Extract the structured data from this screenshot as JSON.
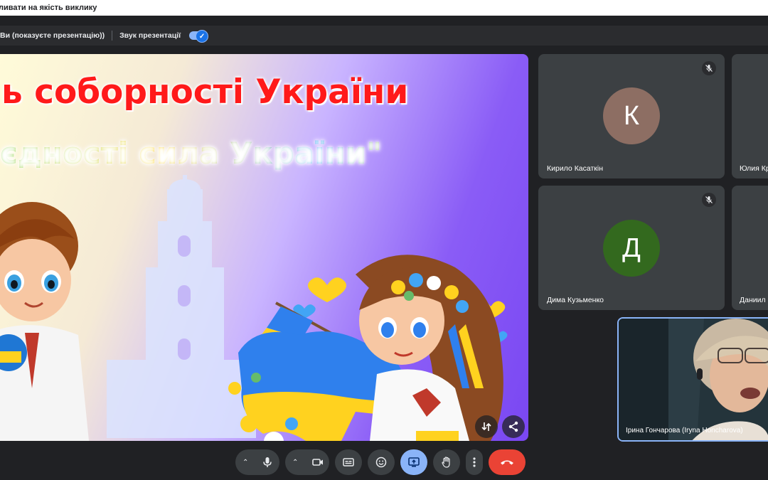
{
  "banner": {
    "text": "ливати на якість виклику"
  },
  "presentation_bar": {
    "presenter_text": "Ви (показуєте презентацію))",
    "sound_label": "Звук презентації",
    "sound_enabled": true
  },
  "slide": {
    "title": "ь соборності України",
    "subtitle": "єдності сила України\""
  },
  "participants": [
    {
      "name": "Кирило Касаткін",
      "initial": "К",
      "avatar_color": "#8d6e63",
      "muted": true
    },
    {
      "name": "Юлия Кр",
      "initial": "",
      "avatar_color": "",
      "muted": false
    },
    {
      "name": "Дима Кузьменко",
      "initial": "Д",
      "avatar_color": "#33691e",
      "muted": true
    },
    {
      "name": "Даниил",
      "initial": "",
      "avatar_color": "",
      "muted": false
    }
  ],
  "self_view": {
    "name": "Ірина Гончарова (Iryna Honcharova)"
  },
  "controls": {
    "icons": [
      "chevron-up-icon",
      "microphone-icon",
      "chevron-up-icon",
      "camera-icon",
      "captions-icon",
      "emoji-icon",
      "present-screen-icon",
      "raise-hand-icon",
      "more-options-icon",
      "end-call-icon"
    ],
    "colors": {
      "present_active": "#8ab4f8",
      "end_call": "#ea4335"
    }
  }
}
